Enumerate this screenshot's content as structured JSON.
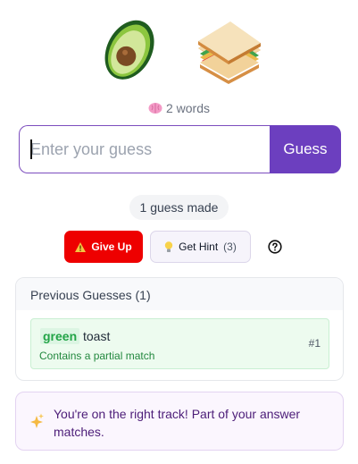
{
  "header": {
    "emojis": [
      "avocado-emoji",
      "sandwich-emoji"
    ],
    "word_count_icon": "brain-icon",
    "word_count": "2 words"
  },
  "guess_form": {
    "placeholder": "Enter your guess",
    "value": "",
    "submit_label": "Guess",
    "accent_color": "#6c3fbf"
  },
  "status": {
    "guesses_made": "1 guess made"
  },
  "actions": {
    "give_up_icon": "warning-icon",
    "give_up_label": "Give Up",
    "hint_icon": "lightbulb-icon",
    "hint_label": "Get Hint",
    "hint_count": "(3)",
    "help_icon": "question-circle-icon"
  },
  "previous_guesses": {
    "title": "Previous Guesses (1)",
    "items": [
      {
        "words": [
          {
            "text": "green",
            "status": "match",
            "color": "#22a447"
          },
          {
            "text": "toast",
            "status": "none"
          }
        ],
        "note": "Contains a partial match",
        "number": "#1"
      }
    ]
  },
  "feedback": {
    "icon": "sparkle-icon",
    "message": "You're on the right track! Part of your answer matches."
  }
}
